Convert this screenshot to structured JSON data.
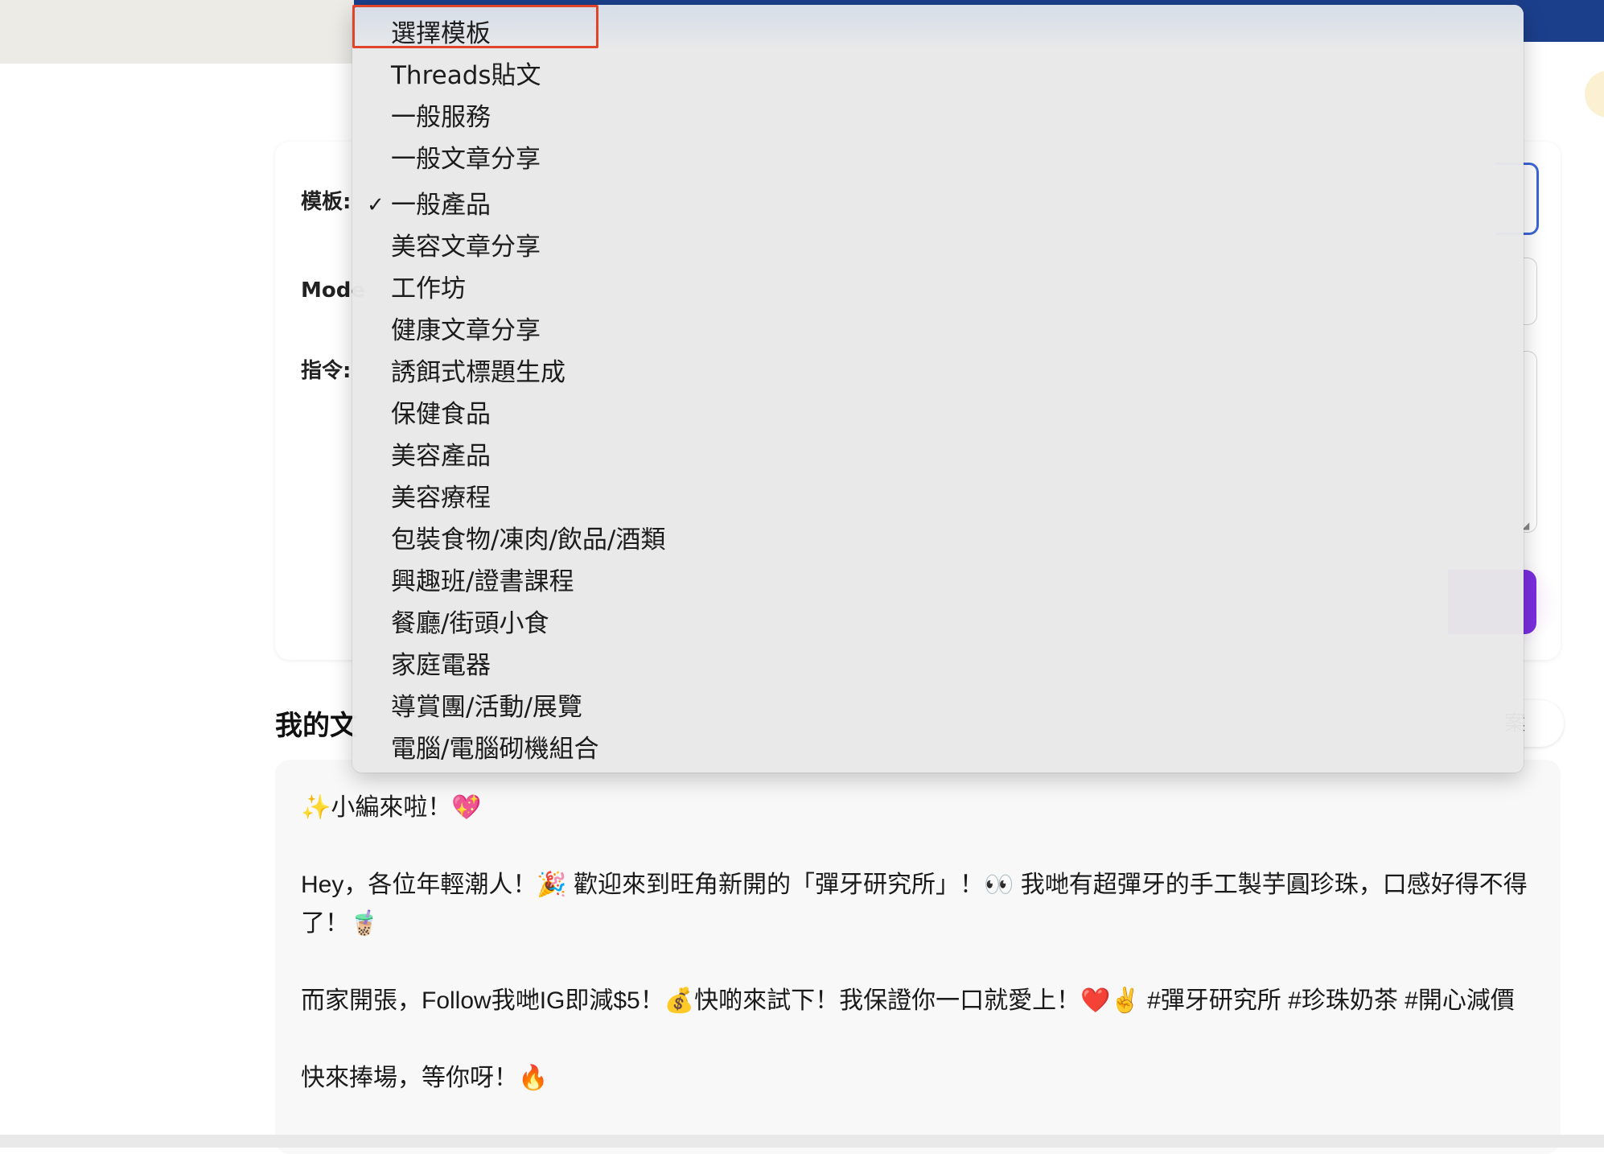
{
  "form": {
    "template_label": "模板:",
    "model_label": "Mode",
    "instruction_label": "指令:"
  },
  "dropdown": {
    "selected": "一般產品",
    "options": [
      "選擇模板",
      "Threads貼文",
      "一般服務",
      "一般文章分享",
      "一般產品",
      "美容文章分享",
      "工作坊",
      "健康文章分享",
      "誘餌式標題生成",
      "保健食品",
      "美容產品",
      "美容療程",
      "包裝食物/凍肉/飲品/酒類",
      "興趣班/證書課程",
      "餐廳/街頭小食",
      "家庭電器",
      "導賞團/活動/展覽",
      "電腦/電腦砌機組合"
    ],
    "checkmark": "✓"
  },
  "posts": {
    "title": "我的文",
    "file_button_label": "案",
    "body": [
      "✨小編來啦！💖",
      "Hey，各位年輕潮人！🎉 歡迎來到旺角新開的「彈牙研究所」！👀 我哋有超彈牙的手工製芋圓珍珠，口感好得不得了！🧋",
      "而家開張，Follow我哋IG即減$5！💰快啲來試下！我保證你一口就愛上！❤️✌️ #彈牙研究所 #珍珠奶茶 #開心減價",
      "快來捧場，等你呀！🔥"
    ]
  },
  "colors": {
    "top_bar": "#1c3f8c",
    "accent_button": "#7a2fe0",
    "highlight_border": "#e0452c",
    "focus_border": "#3b66d8"
  }
}
